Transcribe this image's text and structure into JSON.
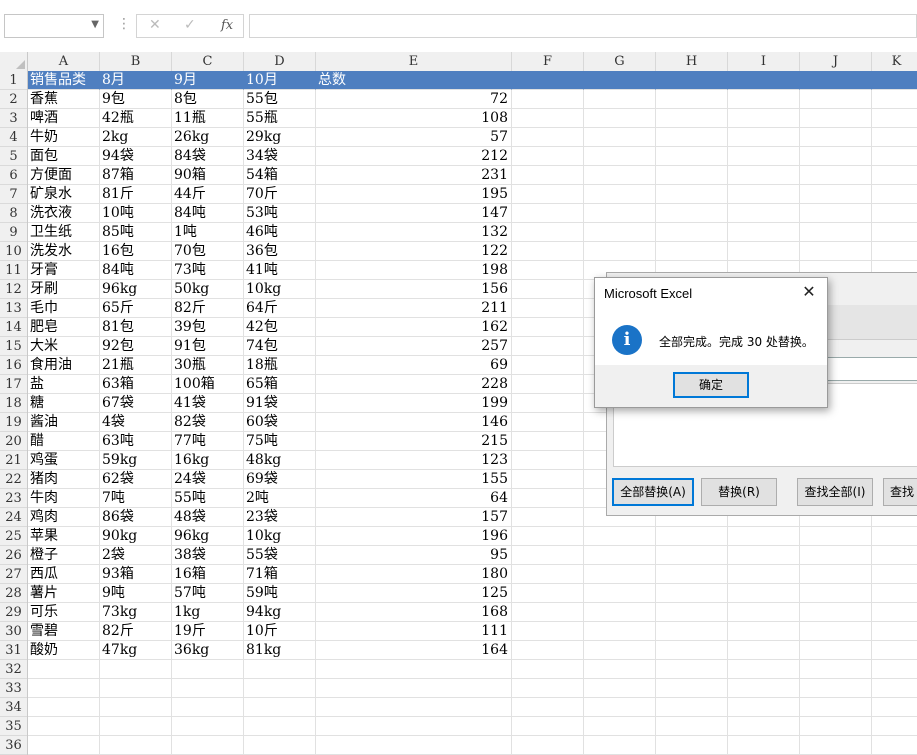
{
  "formula_bar": {
    "name_box": "",
    "cancel_icon": "✕",
    "enter_icon": "✓",
    "fx_label": "fx",
    "formula": ""
  },
  "columns": [
    "A",
    "B",
    "C",
    "D",
    "E",
    "F",
    "G",
    "H",
    "I",
    "J",
    "K"
  ],
  "row_numbers": [
    "1",
    "2",
    "3",
    "4",
    "5",
    "6",
    "7",
    "8",
    "9",
    "10",
    "11",
    "12",
    "13",
    "14",
    "15",
    "16",
    "17",
    "18",
    "19",
    "20",
    "21",
    "22",
    "23",
    "24",
    "25",
    "26",
    "27",
    "28",
    "29",
    "30",
    "31",
    "32",
    "33",
    "34",
    "35",
    "36"
  ],
  "header_row": [
    "销售品类",
    "8月",
    "9月",
    "10月",
    "总数"
  ],
  "rows": [
    [
      "香蕉",
      "9包",
      "8包",
      "55包",
      "72"
    ],
    [
      "啤酒",
      "42瓶",
      "11瓶",
      "55瓶",
      "108"
    ],
    [
      "牛奶",
      "2kg",
      "26kg",
      "29kg",
      "57"
    ],
    [
      "面包",
      "94袋",
      "84袋",
      "34袋",
      "212"
    ],
    [
      "方便面",
      "87箱",
      "90箱",
      "54箱",
      "231"
    ],
    [
      "矿泉水",
      "81斤",
      "44斤",
      "70斤",
      "195"
    ],
    [
      "洗衣液",
      "10吨",
      "84吨",
      "53吨",
      "147"
    ],
    [
      "卫生纸",
      "85吨",
      "1吨",
      "46吨",
      "132"
    ],
    [
      "洗发水",
      "16包",
      "70包",
      "36包",
      "122"
    ],
    [
      "牙膏",
      "84吨",
      "73吨",
      "41吨",
      "198"
    ],
    [
      "牙刷",
      "96kg",
      "50kg",
      "10kg",
      "156"
    ],
    [
      "毛巾",
      "65斤",
      "82斤",
      "64斤",
      "211"
    ],
    [
      "肥皂",
      "81包",
      "39包",
      "42包",
      "162"
    ],
    [
      "大米",
      "92包",
      "91包",
      "74包",
      "257"
    ],
    [
      "食用油",
      "21瓶",
      "30瓶",
      "18瓶",
      "69"
    ],
    [
      "盐",
      "63箱",
      "100箱",
      "65箱",
      "228"
    ],
    [
      "糖",
      "67袋",
      "41袋",
      "91袋",
      "199"
    ],
    [
      "酱油",
      "4袋",
      "82袋",
      "60袋",
      "146"
    ],
    [
      "醋",
      "63吨",
      "77吨",
      "75吨",
      "215"
    ],
    [
      "鸡蛋",
      "59kg",
      "16kg",
      "48kg",
      "123"
    ],
    [
      "猪肉",
      "62袋",
      "24袋",
      "69袋",
      "155"
    ],
    [
      "牛肉",
      "7吨",
      "55吨",
      "2吨",
      "64"
    ],
    [
      "鸡肉",
      "86袋",
      "48袋",
      "23袋",
      "157"
    ],
    [
      "苹果",
      "90kg",
      "96kg",
      "10kg",
      "196"
    ],
    [
      "橙子",
      "2袋",
      "38袋",
      "55袋",
      "95"
    ],
    [
      "西瓜",
      "93箱",
      "16箱",
      "71箱",
      "180"
    ],
    [
      "薯片",
      "9吨",
      "57吨",
      "59吨",
      "125"
    ],
    [
      "可乐",
      "73kg",
      "1kg",
      "94kg",
      "168"
    ],
    [
      "雪碧",
      "82斤",
      "19斤",
      "10斤",
      "111"
    ],
    [
      "酸奶",
      "47kg",
      "36kg",
      "81kg",
      "164"
    ]
  ],
  "find_replace": {
    "replace_all": "全部替换(A)",
    "replace": "替换(R)",
    "find_all": "查找全部(I)",
    "find_next": "查找"
  },
  "message_box": {
    "title": "Microsoft Excel",
    "close_icon": "✕",
    "info_icon": "i",
    "message": "全部完成。完成 30 处替换。",
    "ok": "确定"
  },
  "colors": {
    "header_fill": "#4f7fc0",
    "accent": "#0078d7",
    "info": "#1a73c7"
  }
}
